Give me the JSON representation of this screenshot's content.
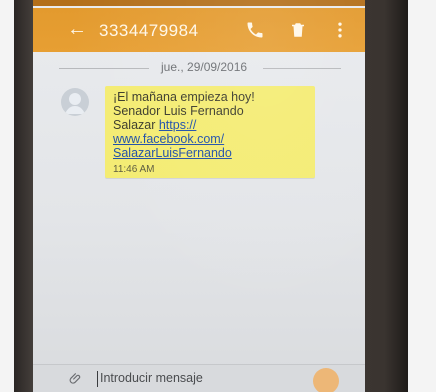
{
  "header": {
    "phone_number": "3334479984"
  },
  "conversation": {
    "date": "jue., 29/09/2016",
    "message": {
      "line_1": "¡El mañana empieza hoy!",
      "line_2": "Senador Luis Fernando",
      "line_3_prefix": "Salazar ",
      "link_1": "https://",
      "link_2": "www.facebook.com/",
      "link_3": "SalazarLuisFernando",
      "time": "11:46 AM"
    }
  },
  "composer": {
    "placeholder": "Introducir mensaje"
  },
  "colors": {
    "appbar": "#e79f33",
    "bubble": "#f4ec72",
    "link": "#1f4fa8"
  },
  "icons": {
    "back": "back-arrow-icon",
    "call": "phone-icon",
    "delete": "trash-icon",
    "more": "more-vertical-icon",
    "attach": "paperclip-icon",
    "send": "send-icon"
  }
}
